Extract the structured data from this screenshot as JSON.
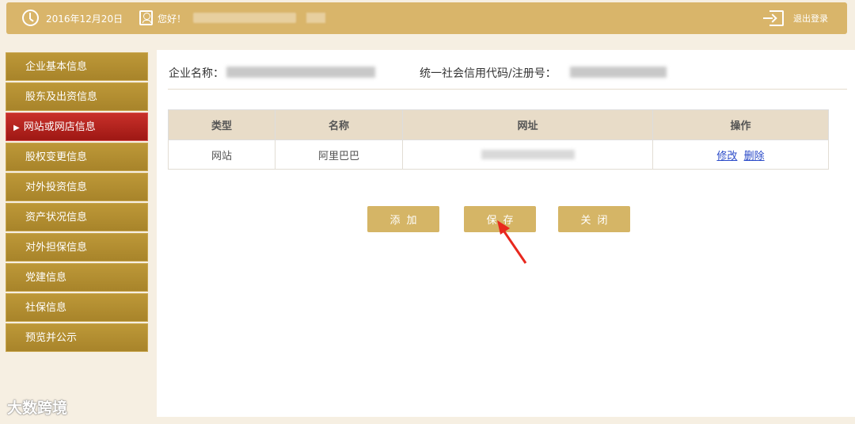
{
  "header": {
    "date": "2016年12月20日",
    "greeting": "您好！",
    "logout_label": "退出登录"
  },
  "sidebar": {
    "items": [
      {
        "label": "企业基本信息",
        "active": false
      },
      {
        "label": "股东及出资信息",
        "active": false
      },
      {
        "label": "网站或网店信息",
        "active": true
      },
      {
        "label": "股权变更信息",
        "active": false
      },
      {
        "label": "对外投资信息",
        "active": false
      },
      {
        "label": "资产状况信息",
        "active": false
      },
      {
        "label": "对外担保信息",
        "active": false
      },
      {
        "label": "党建信息",
        "active": false
      },
      {
        "label": "社保信息",
        "active": false
      },
      {
        "label": "预览并公示",
        "active": false
      }
    ]
  },
  "main": {
    "company_label": "企业名称：",
    "code_label": "统一社会信用代码/注册号：",
    "table": {
      "headers": [
        "类型",
        "名称",
        "网址",
        "操作"
      ],
      "rows": [
        {
          "type": "网站",
          "name": "阿里巴巴",
          "edit": "修改",
          "delete": "删除"
        }
      ]
    },
    "buttons": {
      "add": "添加",
      "save": "保存",
      "close": "关闭"
    }
  },
  "watermark": "大数跨境",
  "colors": {
    "header_bg": "#d9b56a",
    "sidebar_bg": "#b7912f",
    "sidebar_active": "#c8302a",
    "button_bg": "#d5b566",
    "link": "#2a4ac8"
  }
}
